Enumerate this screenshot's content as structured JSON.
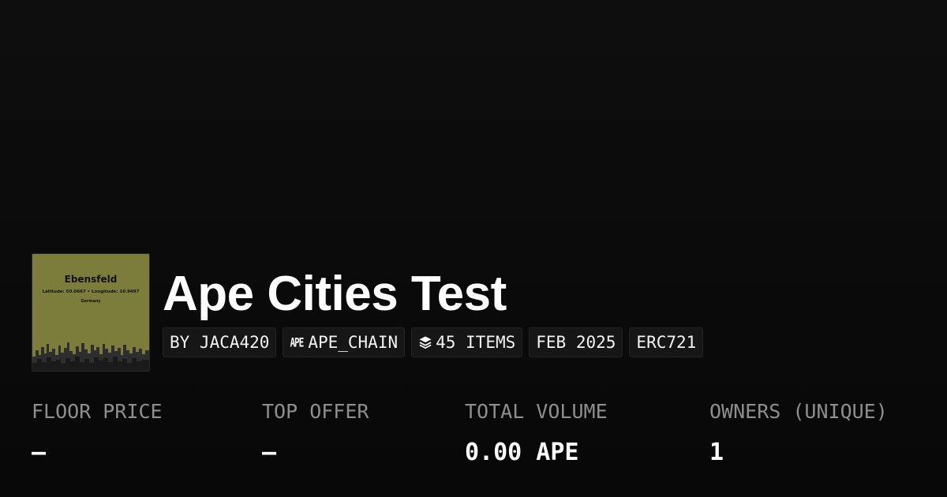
{
  "collection": {
    "title": "Ape Cities Test",
    "thumbnail": {
      "city": "Ebensfeld",
      "coords": "Latitude: 50.0667 • Longitude: 10.9497",
      "country": "Germany",
      "background_color": "#7d7d3b"
    },
    "chips": {
      "creator": "BY JACA420",
      "chain_logo": "APE",
      "chain": "APE_CHAIN",
      "chain_icon": "ape-chain-logo-icon",
      "items": "45 ITEMS",
      "items_icon": "layers-stack-icon",
      "date": "FEB 2025",
      "standard": "ERC721"
    }
  },
  "stats": [
    {
      "label": "FLOOR PRICE",
      "value": "–"
    },
    {
      "label": "TOP OFFER",
      "value": "–"
    },
    {
      "label": "TOTAL VOLUME",
      "value": "0.00 APE"
    },
    {
      "label": "OWNERS (UNIQUE)",
      "value": "1"
    }
  ]
}
